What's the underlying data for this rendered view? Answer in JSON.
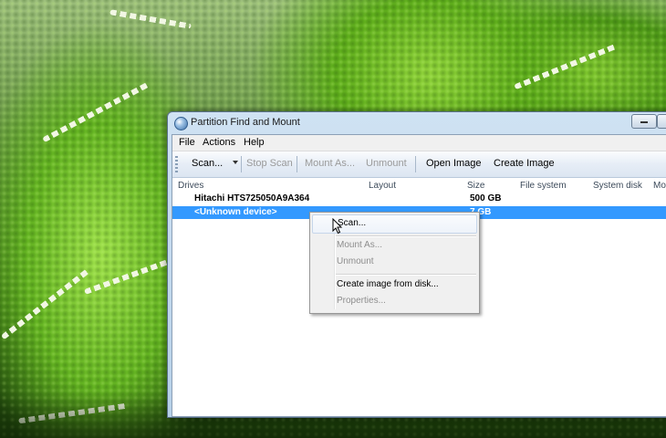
{
  "window": {
    "title": "Partition Find and Mount"
  },
  "menubar": {
    "items": [
      "File",
      "Actions",
      "Help"
    ]
  },
  "toolbar": {
    "scan": "Scan...",
    "stop_scan": "Stop Scan",
    "mount_as": "Mount As...",
    "unmount": "Unmount",
    "open_image": "Open Image",
    "create_image": "Create Image"
  },
  "list": {
    "columns": [
      "Drives",
      "Layout",
      "Size",
      "File system",
      "System disk",
      "Mo"
    ],
    "rows": [
      {
        "drive": "Hitachi HTS725050A9A364",
        "size": "500 GB",
        "selected": false
      },
      {
        "drive": "<Unknown device>",
        "size": "7 GB",
        "selected": true
      }
    ]
  },
  "context_menu": {
    "items": [
      {
        "label": "Scan...",
        "enabled": true,
        "hover": true
      },
      {
        "label": "Mount As...",
        "enabled": false
      },
      {
        "label": "Unmount",
        "enabled": false
      },
      {
        "label": "Create image from disk...",
        "enabled": true
      },
      {
        "label": "Properties...",
        "enabled": false
      }
    ]
  },
  "colors": {
    "selection": "#3399ff",
    "window_chrome": "#cfe2f3",
    "wallpaper_green": "#64b422"
  }
}
